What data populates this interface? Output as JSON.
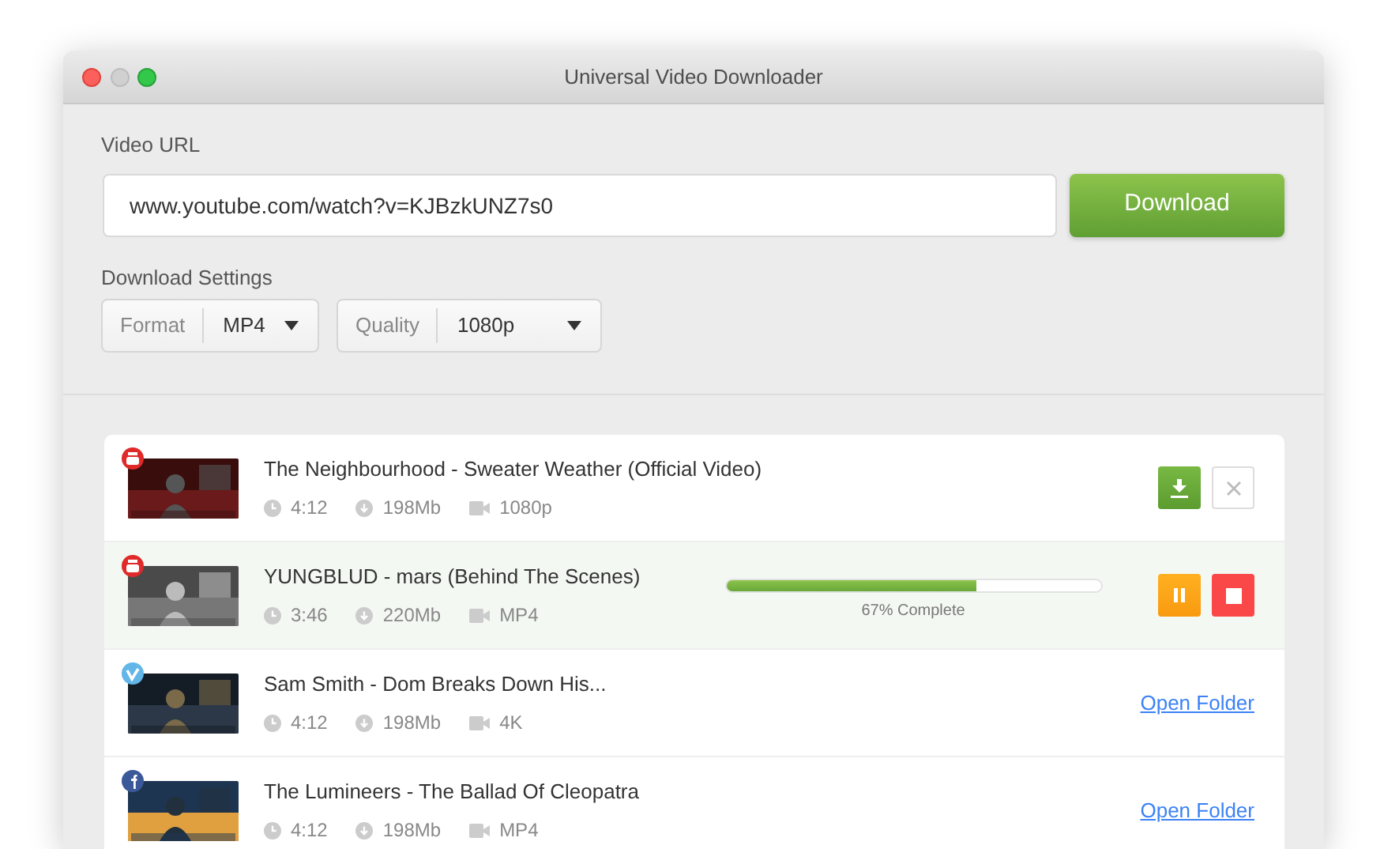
{
  "window": {
    "title": "Universal Video Downloader"
  },
  "url": {
    "label": "Video URL",
    "value": "www.youtube.com/watch?v=KJBzkUNZ7s0"
  },
  "download_button": "Download",
  "settings": {
    "label": "Download Settings",
    "selects": [
      {
        "label": "Format",
        "value": "MP4"
      },
      {
        "label": "Quality",
        "value": "1080p"
      }
    ]
  },
  "downloads": [
    {
      "title": "The Neighbourhood - Sweater Weather (Official Video)",
      "badge": {
        "kind": "youtube"
      },
      "duration": "4:12",
      "size": "198Mb",
      "format": "1080p",
      "kind": "pending",
      "selected": false
    },
    {
      "title": "YUNGBLUD - mars (Behind The Scenes)",
      "badge": {
        "kind": "youtube"
      },
      "duration": "3:46",
      "size": "220Mb",
      "format": "MP4",
      "kind": "downloading",
      "selected": true,
      "level": 0.67,
      "progress_text": "67% Complete"
    },
    {
      "title": "Sam Smith - Dom Breaks Down His...",
      "badge": {
        "kind": "vimeo"
      },
      "duration": "4:12",
      "size": "198Mb",
      "format": "4K",
      "kind": "done",
      "selected": false,
      "link": "Open Folder"
    },
    {
      "title": "The Lumineers - The Ballad Of Cleopatra",
      "badge": {
        "kind": "facebook"
      },
      "duration": "4:12",
      "size": "198Mb",
      "format": "MP4",
      "kind": "done",
      "selected": false,
      "link": "Open Folder"
    }
  ]
}
